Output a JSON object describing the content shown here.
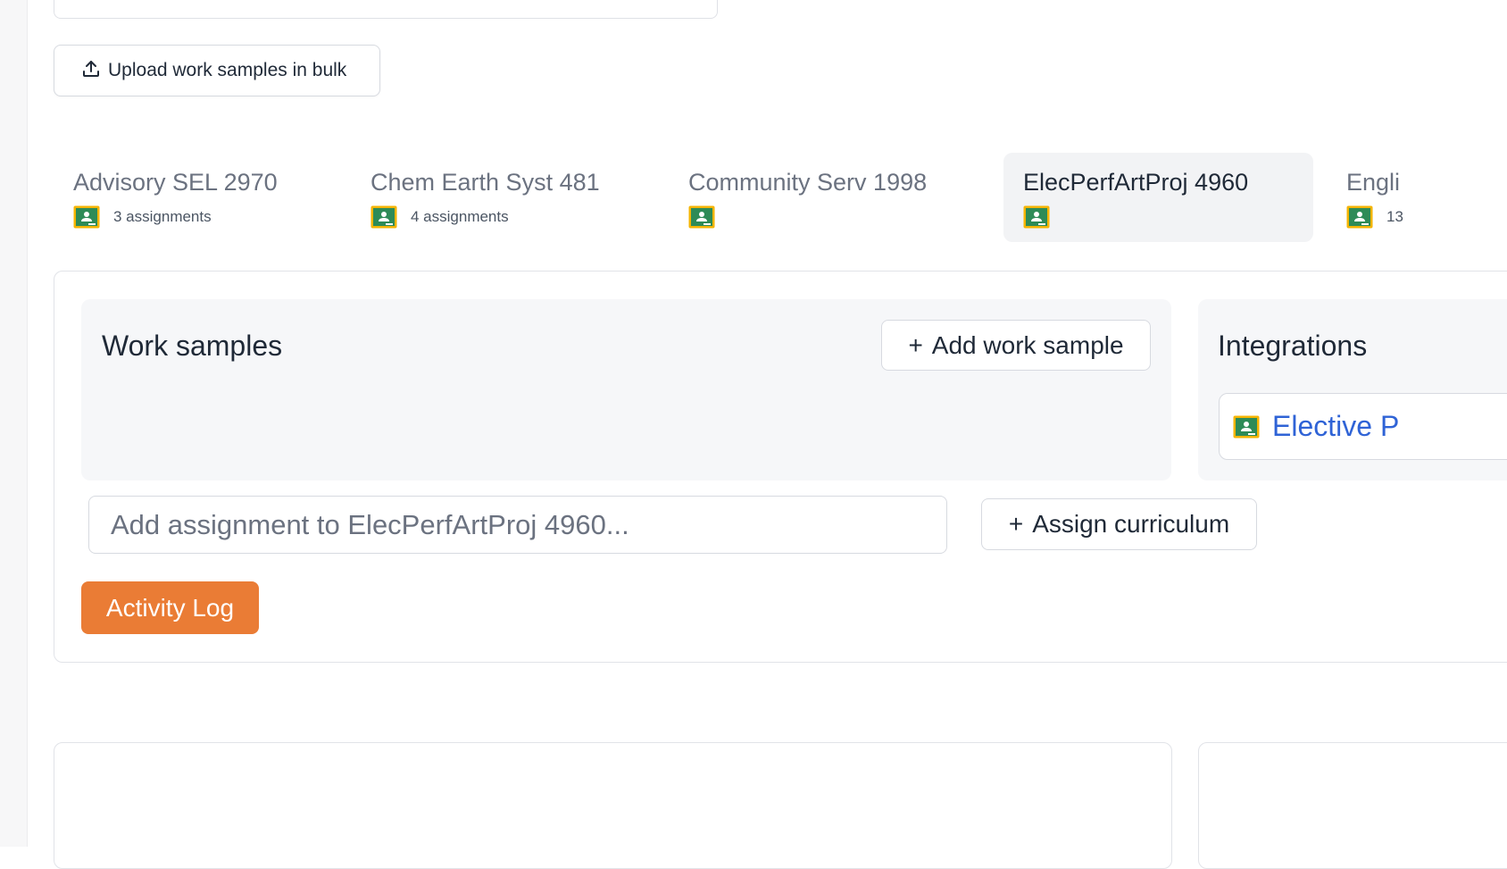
{
  "toolbar": {
    "upload_label": "Upload work samples in bulk"
  },
  "course_tabs": [
    {
      "name": "Advisory SEL 2970",
      "count": "3 assignments",
      "active": false
    },
    {
      "name": "Chem Earth Syst 481",
      "count": "4 assignments",
      "active": false
    },
    {
      "name": "Community Serv 1998",
      "count": "",
      "active": false
    },
    {
      "name": "ElecPerfArtProj 4960",
      "count": "",
      "active": true
    },
    {
      "name": "Engli",
      "count": "13",
      "active": false
    }
  ],
  "work_samples": {
    "title": "Work samples",
    "add_label": "Add work sample",
    "add_icon": "+"
  },
  "integrations": {
    "title": "Integrations",
    "link_label": "Elective P",
    "link_icon": "google-classroom-icon"
  },
  "assignment": {
    "placeholder": "Add assignment to ElecPerfArtProj 4960...",
    "value": ""
  },
  "assign_curriculum": {
    "label": "Assign curriculum",
    "icon": "+"
  },
  "activity_log": {
    "label": "Activity Log"
  },
  "colors": {
    "accent_orange": "#ea7c35",
    "link_blue": "#2f63d6",
    "classroom_green": "#2e8b57",
    "classroom_yellow": "#f4b400",
    "active_tab_bg": "#f2f3f5",
    "panel_bg": "#f6f7f9"
  }
}
